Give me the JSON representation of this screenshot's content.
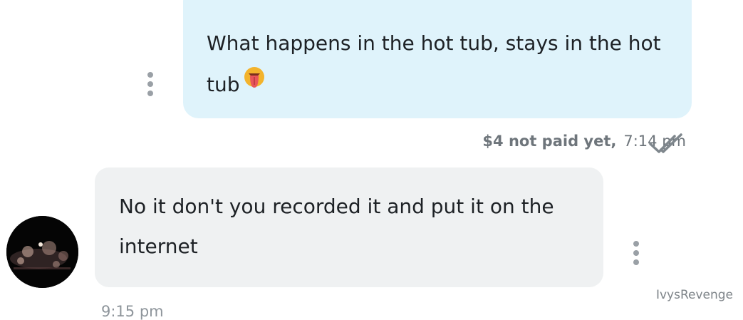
{
  "messages": [
    {
      "direction": "sent",
      "text": "What happens in the hot tub, stays in the hot tub",
      "emoji": "tongue-emoji",
      "price_status": "$4 not paid yet",
      "separator": ",",
      "time": "7:14 pm",
      "status_icon": "double-check-icon"
    },
    {
      "direction": "received",
      "text": "No it don't you recorded it and put it on the internet",
      "time": "9:15 pm",
      "avatar": "night-sky-avatar"
    }
  ],
  "watermark": "IvysRevenge",
  "colors": {
    "sent_bubble": "#dff3fb",
    "received_bubble": "#eff1f2",
    "meta_text": "#6e757b",
    "check_icon": "#7f878d"
  }
}
